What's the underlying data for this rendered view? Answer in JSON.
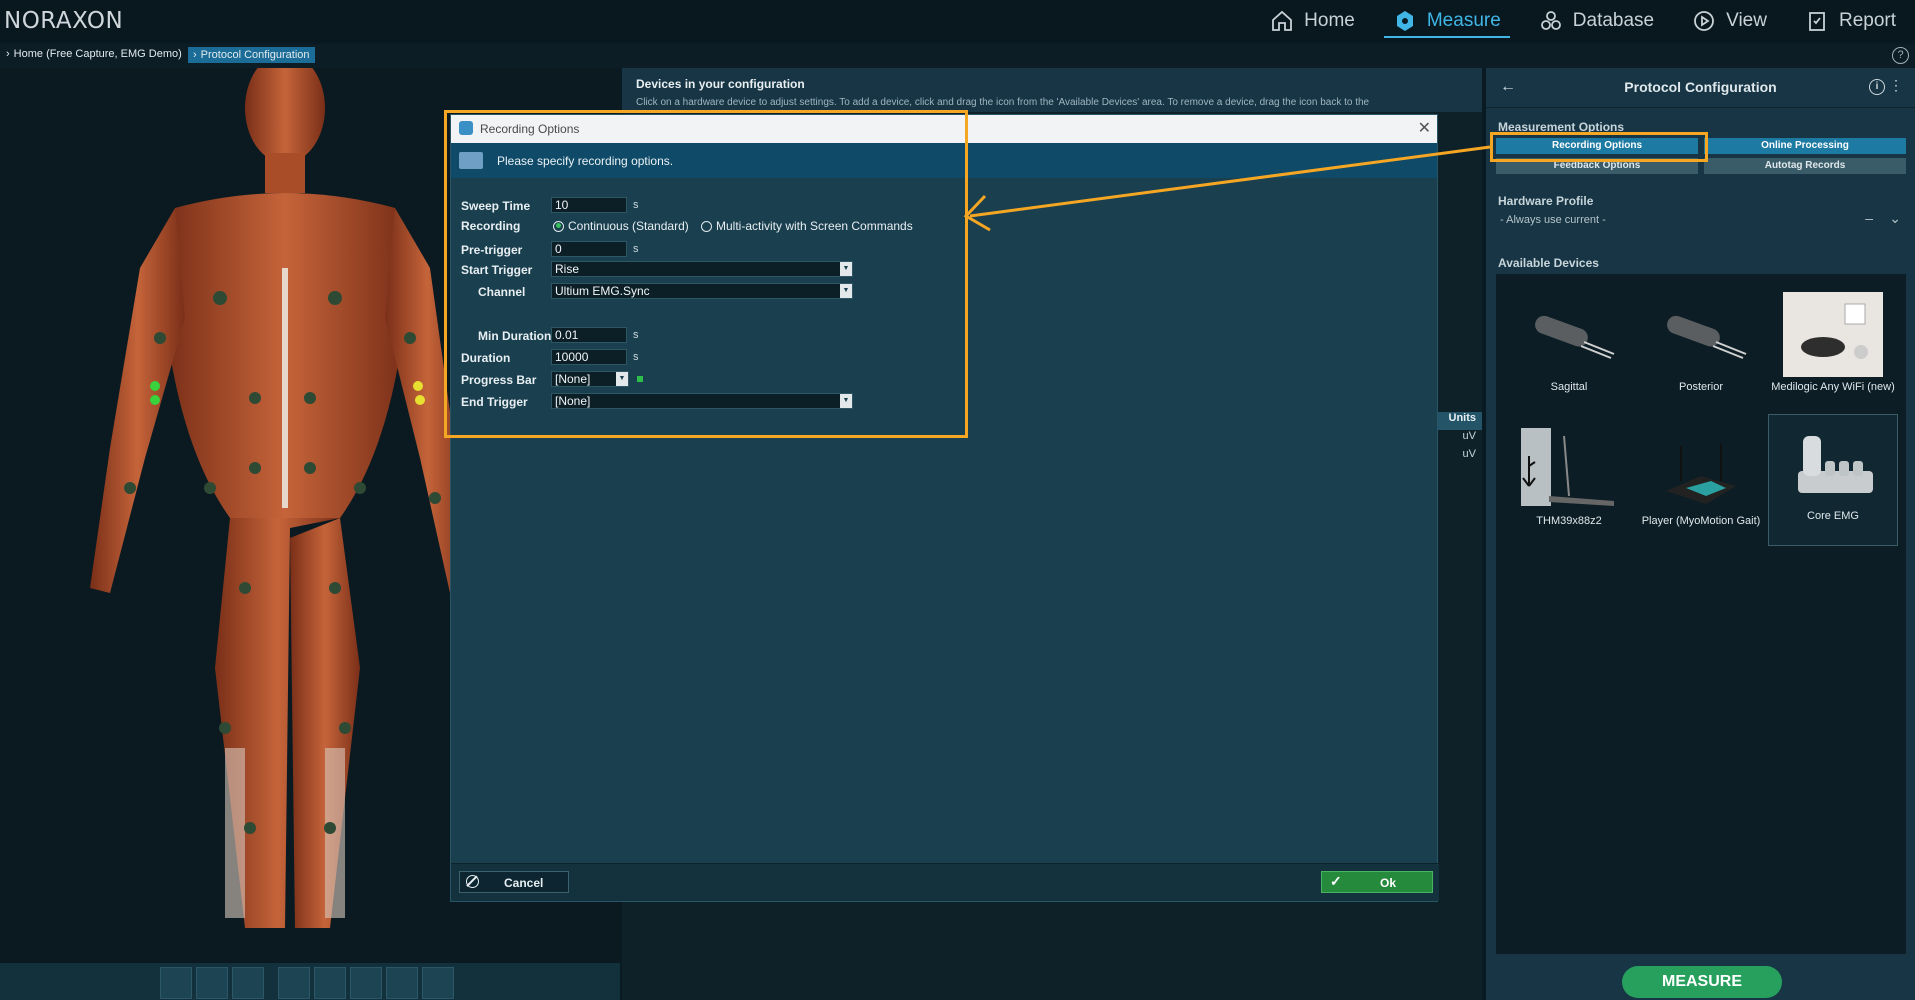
{
  "app": {
    "logo": "NORAXON"
  },
  "nav": [
    {
      "label": "Home",
      "icon": "home-icon"
    },
    {
      "label": "Measure",
      "icon": "measure-icon"
    },
    {
      "label": "Database",
      "icon": "database-icon"
    },
    {
      "label": "View",
      "icon": "play-icon"
    },
    {
      "label": "Report",
      "icon": "report-icon"
    }
  ],
  "breadcrumb": {
    "home": "Home (Free Capture, EMG Demo)",
    "current": "Protocol Configuration"
  },
  "center": {
    "title": "Devices in your configuration",
    "subtitle": "Click on a hardware device to adjust settings. To add a device, click and drag the icon from the 'Available Devices' area. To remove a device, drag the icon back to the",
    "units_header": "Units",
    "units": [
      "uV",
      "uV"
    ]
  },
  "right_panel": {
    "title": "Protocol Configuration",
    "measurement_options_label": "Measurement Options",
    "buttons": {
      "recording": "Recording Options",
      "online": "Online Processing",
      "feedback": "Feedback Options",
      "autotag": "Autotag Records"
    },
    "hardware_profile_label": "Hardware Profile",
    "hardware_profile_value": "- Always use current -",
    "available_devices_label": "Available Devices",
    "devices": [
      {
        "label": "Sagittal"
      },
      {
        "label": "Posterior"
      },
      {
        "label": "Medilogic Any WiFi (new)"
      },
      {
        "label": "THM39x88z2"
      },
      {
        "label": "Player (MyoMotion Gait)"
      },
      {
        "label": "Core EMG"
      }
    ],
    "measure_button": "MEASURE"
  },
  "dialog": {
    "title": "Recording Options",
    "banner": "Please specify recording options.",
    "fields": {
      "sweep_time_label": "Sweep Time",
      "sweep_time_value": "10",
      "sweep_time_unit": "s",
      "recording_label": "Recording",
      "recording_opt1": "Continuous (Standard)",
      "recording_opt2": "Multi-activity with Screen Commands",
      "pretrigger_label": "Pre-trigger",
      "pretrigger_value": "0",
      "pretrigger_unit": "s",
      "start_trigger_label": "Start Trigger",
      "start_trigger_value": "Rise",
      "channel_label": "Channel",
      "channel_value": "Ultium EMG.Sync",
      "min_duration_label": "Min Duration",
      "min_duration_value": "0.01",
      "min_duration_unit": "s",
      "duration_label": "Duration",
      "duration_value": "10000",
      "duration_unit": "s",
      "progress_bar_label": "Progress Bar",
      "progress_bar_value": "[None]",
      "end_trigger_label": "End Trigger",
      "end_trigger_value": "[None]"
    },
    "cancel_label": "Cancel",
    "ok_label": "Ok"
  },
  "colors": {
    "accent": "#3fb6e6",
    "highlight": "#f5a623",
    "measure_green": "#27a05d"
  }
}
